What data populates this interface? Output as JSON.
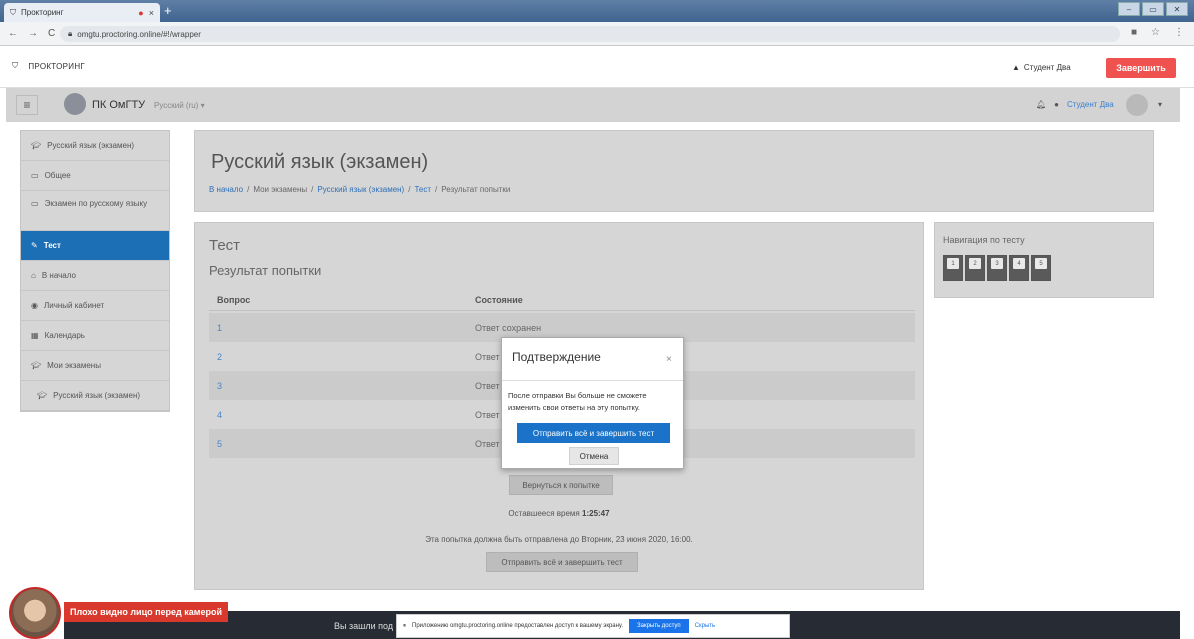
{
  "browser": {
    "tab_title": "Прокторинг",
    "tab_close": "×",
    "new_tab": "+",
    "url": "omgtu.proctoring.online/#!/wrapper"
  },
  "proctor": {
    "title": "ПРОКТОРИНГ",
    "user": "Студент Два",
    "finish": "Завершить"
  },
  "navbar": {
    "brand": "ПК ОмГТУ",
    "language": "Русский (ru) ▾",
    "user": "Студент Два",
    "caret": "▾"
  },
  "sidebar": {
    "items": [
      {
        "label": "Русский язык (экзамен)",
        "icon": "graduation-cap-icon"
      },
      {
        "label": "Общее",
        "icon": "folder-icon"
      },
      {
        "label": "Экзамен по русскому языку",
        "icon": "folder-icon"
      },
      {
        "label": "Тест",
        "icon": "quiz-icon"
      },
      {
        "label": "В начало",
        "icon": "home-icon"
      },
      {
        "label": "Личный кабинет",
        "icon": "dashboard-icon"
      },
      {
        "label": "Календарь",
        "icon": "calendar-icon"
      },
      {
        "label": "Мои экзамены",
        "icon": "graduation-cap-icon"
      },
      {
        "label": "Русский язык (экзамен)",
        "icon": "graduation-cap-icon"
      }
    ]
  },
  "header": {
    "title": "Русский язык (экзамен)",
    "breadcrumb": [
      "В начало",
      "/",
      "Мои экзамены",
      "/",
      "Русский язык (экзамен)",
      "/",
      "Тест",
      "/",
      "Результат попытки"
    ]
  },
  "main": {
    "title": "Тест",
    "subtitle": "Результат попытки",
    "col_question": "Вопрос",
    "col_status": "Состояние",
    "rows": [
      {
        "q": "1",
        "status": "Ответ сохранен"
      },
      {
        "q": "2",
        "status": "Ответ"
      },
      {
        "q": "3",
        "status": "Ответ"
      },
      {
        "q": "4",
        "status": "Ответ"
      },
      {
        "q": "5",
        "status": "Ответ"
      }
    ],
    "return_button": "Вернуться к попытке",
    "time_label": "Оставшееся время",
    "time_value": "1:25:47",
    "deadline": "Эта попытка должна быть отправлена до Вторник, 23 июня 2020, 16:00.",
    "submit_button": "Отправить всё и завершить тест"
  },
  "quiz_nav": {
    "title": "Навигация по тесту",
    "buttons": [
      "1",
      "2",
      "3",
      "4",
      "5"
    ]
  },
  "footer": {
    "text": "Вы зашли под"
  },
  "modal": {
    "title": "Подтверждение",
    "close": "×",
    "body": "После отправки Вы больше не сможете изменить свои ответы на эту попытку.",
    "primary": "Отправить всё и завершить тест",
    "cancel": "Отмена"
  },
  "warning": {
    "text": "Плохо видно лицо перед камерой"
  },
  "share": {
    "text": "Приложению omgtu.proctoring.online предоставлен доступ к вашему экрану.",
    "stop": "Закрыть доступ",
    "hide": "Скрыть"
  },
  "colors": {
    "accent": "#1c6fb4",
    "danger": "#f0524f"
  }
}
